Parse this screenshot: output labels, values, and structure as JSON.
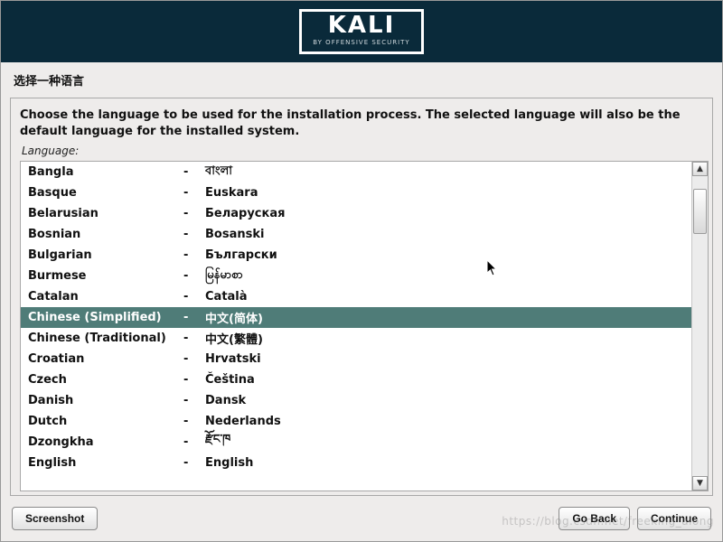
{
  "banner": {
    "title": "KALI",
    "subtitle": "BY OFFENSIVE SECURITY"
  },
  "header": {
    "title": "选择一种语言"
  },
  "panel": {
    "instruction": "Choose the language to be used for the installation process. The selected language will also be the default language for the installed system.",
    "field_label": "Language:"
  },
  "languages": [
    {
      "en": "Bangla",
      "native": "বাংলা",
      "selected": false
    },
    {
      "en": "Basque",
      "native": "Euskara",
      "selected": false
    },
    {
      "en": "Belarusian",
      "native": "Беларуская",
      "selected": false
    },
    {
      "en": "Bosnian",
      "native": "Bosanski",
      "selected": false
    },
    {
      "en": "Bulgarian",
      "native": "Български",
      "selected": false
    },
    {
      "en": "Burmese",
      "native": "မြန်မာစာ",
      "selected": false
    },
    {
      "en": "Catalan",
      "native": "Català",
      "selected": false
    },
    {
      "en": "Chinese (Simplified)",
      "native": "中文(简体)",
      "selected": true
    },
    {
      "en": "Chinese (Traditional)",
      "native": "中文(繁體)",
      "selected": false
    },
    {
      "en": "Croatian",
      "native": "Hrvatski",
      "selected": false
    },
    {
      "en": "Czech",
      "native": "Čeština",
      "selected": false
    },
    {
      "en": "Danish",
      "native": "Dansk",
      "selected": false
    },
    {
      "en": "Dutch",
      "native": "Nederlands",
      "selected": false
    },
    {
      "en": "Dzongkha",
      "native": "རྫོང་ཁ",
      "selected": false
    },
    {
      "en": "English",
      "native": "English",
      "selected": false
    }
  ],
  "dash": "-",
  "buttons": {
    "screenshot": "Screenshot",
    "go_back": "Go Back",
    "continue": "Continue"
  },
  "watermark": "https://blog.csdn.net/freeking_along"
}
